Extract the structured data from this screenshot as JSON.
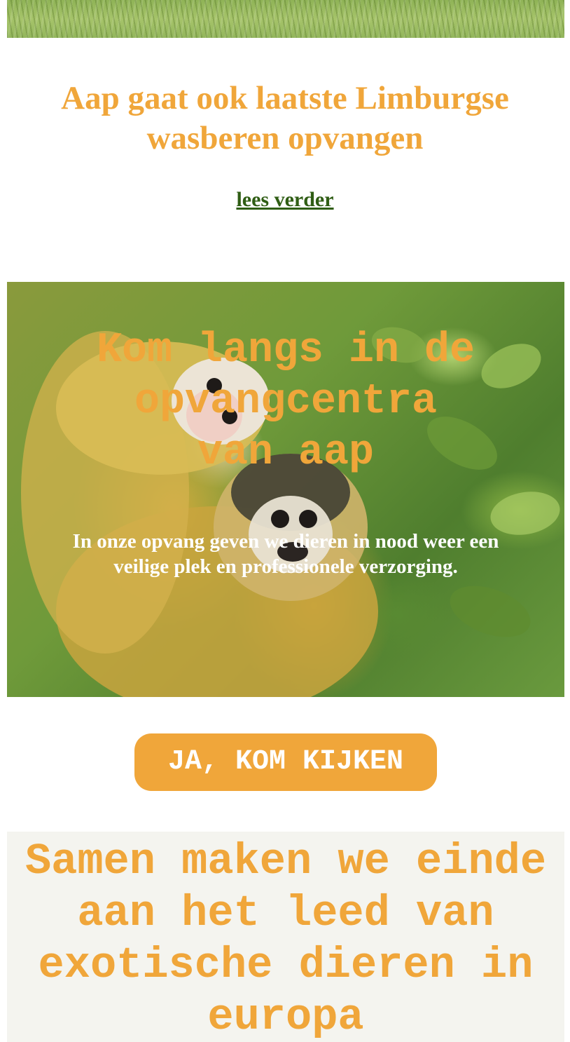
{
  "news": {
    "headline": "Aap gaat ook laatste Limburgse wasberen opvangen",
    "read_more": "lees verder"
  },
  "hero": {
    "title": "Kom langs in de opvangcentra van aap",
    "text": "In onze opvang geven we dieren in nood weer een veilige plek en professionele verzorging."
  },
  "cta": {
    "label": "JA, KOM KIJKEN"
  },
  "closing": {
    "title": "Samen maken we einde aan het leed van exotische dieren in europa"
  },
  "colors": {
    "accent": "#f0a63a",
    "link": "#2f5d14",
    "closing_bg": "#f4f4ef"
  }
}
